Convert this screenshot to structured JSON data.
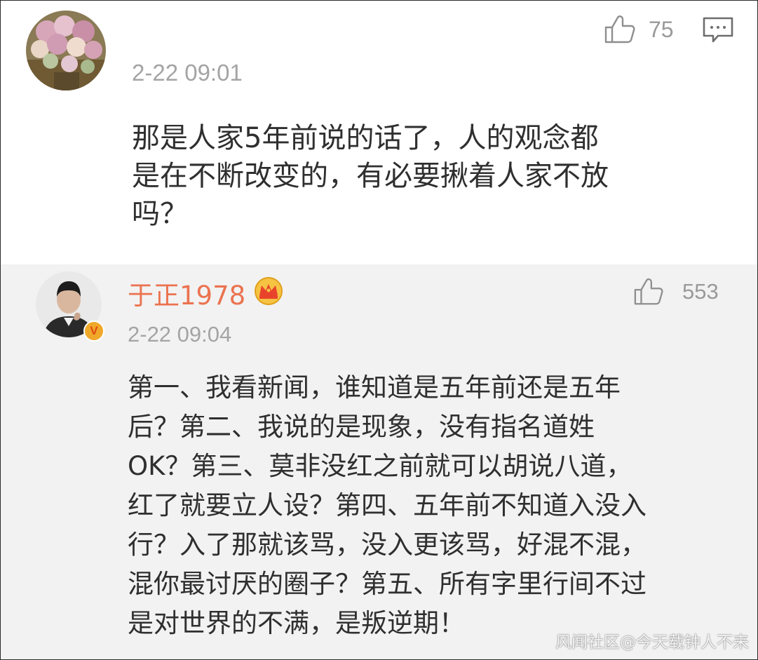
{
  "comment": {
    "avatar_icon": "flower-bouquet-avatar",
    "like_count": "75",
    "timestamp": "2-22 09:01",
    "text_lines": [
      "那是人家5年前说的话了，人的观念都",
      "是在不断改变的，有必要揪着人家不放",
      "吗？"
    ]
  },
  "reply": {
    "avatar_icon": "man-portrait-avatar",
    "verified_badge": "V",
    "username": "于正1978",
    "crown_icon": "vip-crown-icon",
    "like_count": "553",
    "timestamp": "2-22 09:04",
    "text_lines": [
      "第一、我看新闻，谁知道是五年前还是五年",
      "后？第二、我说的是现象，没有指名道姓",
      "OK？第三、莫非没红之前就可以胡说八道，",
      "红了就要立人设？第四、五年前不知道入没入",
      "行？入了那就该骂，没入更该骂，好混不混，",
      "混你最讨厌的圈子？第五、所有字里行间不过",
      "是对世界的不满，是叛逆期！"
    ]
  },
  "watermark": "风闻社区@今天载钟人不来",
  "colors": {
    "username": "#eb7350",
    "meta_gray": "#a4a4a4",
    "body_text": "#2f2f2f",
    "reply_bg": "#f2f2f2"
  }
}
